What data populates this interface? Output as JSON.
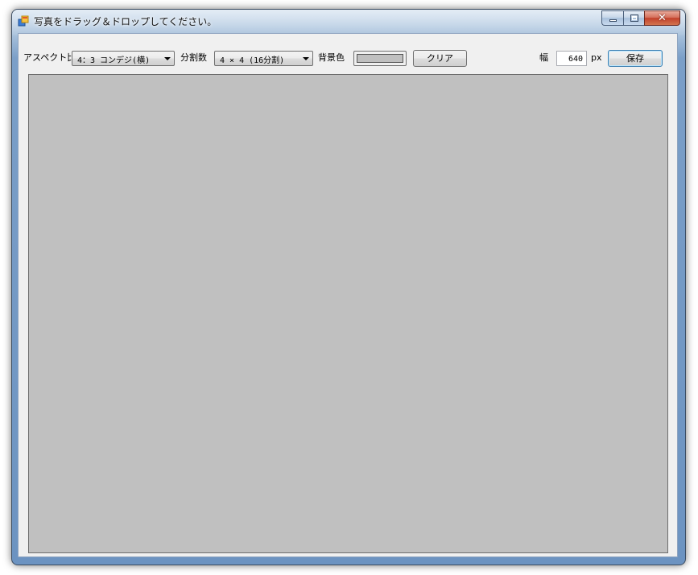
{
  "window": {
    "title": "写真をドラッグ＆ドロップしてください。",
    "icon": "app-window-icon",
    "caption_buttons": {
      "close_glyph": "✕"
    }
  },
  "toolbar": {
    "aspect_label": "アスペクト比",
    "aspect_value": "4：3 コンデジ(横)",
    "divisions_label": "分割数",
    "divisions_value": "4 × 4 (16分割)",
    "bgcolor_label": "背景色",
    "bgcolor_value": "#c0c0c0",
    "clear_label": "クリア",
    "width_label": "幅",
    "width_value": "640",
    "width_unit": "px",
    "save_label": "保存"
  },
  "canvas": {
    "background": "#c0c0c0"
  }
}
